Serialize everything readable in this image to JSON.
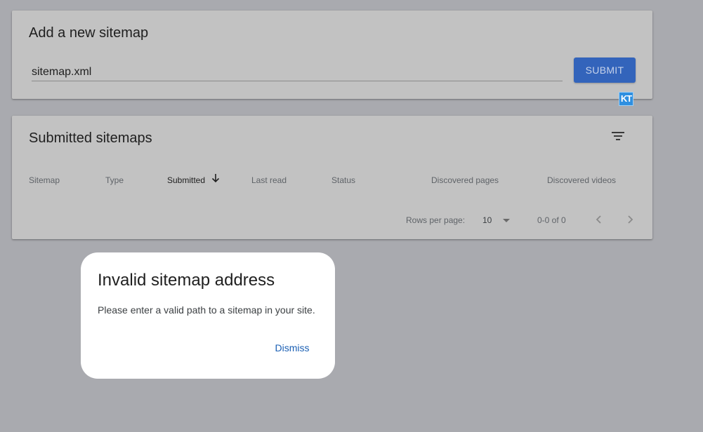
{
  "add_sitemap": {
    "title": "Add a new sitemap",
    "input_value": "sitemap.xml",
    "submit_label": "SUBMIT",
    "extension_badge": "KT"
  },
  "submitted_sitemaps": {
    "title": "Submitted sitemaps",
    "filter_icon": "filter-list-icon",
    "columns": [
      "Sitemap",
      "Type",
      "Submitted",
      "Last read",
      "Status",
      "Discovered pages",
      "Discovered videos"
    ],
    "sorted_column": "Submitted",
    "sort_direction": "descending",
    "pagination": {
      "rows_per_page_label": "Rows per page:",
      "rows_per_page_value": "10",
      "range_text": "0-0 of 0"
    }
  },
  "dialog": {
    "title": "Invalid sitemap address",
    "message": "Please enter a valid path to a sitemap in your site.",
    "dismiss_label": "Dismiss"
  },
  "colors": {
    "page_background": "#a9aaaf",
    "card_background": "#c2c2c2",
    "primary_button": "#3364bb",
    "link_accent": "#1a5fb4",
    "dialog_background": "#ffffff"
  }
}
